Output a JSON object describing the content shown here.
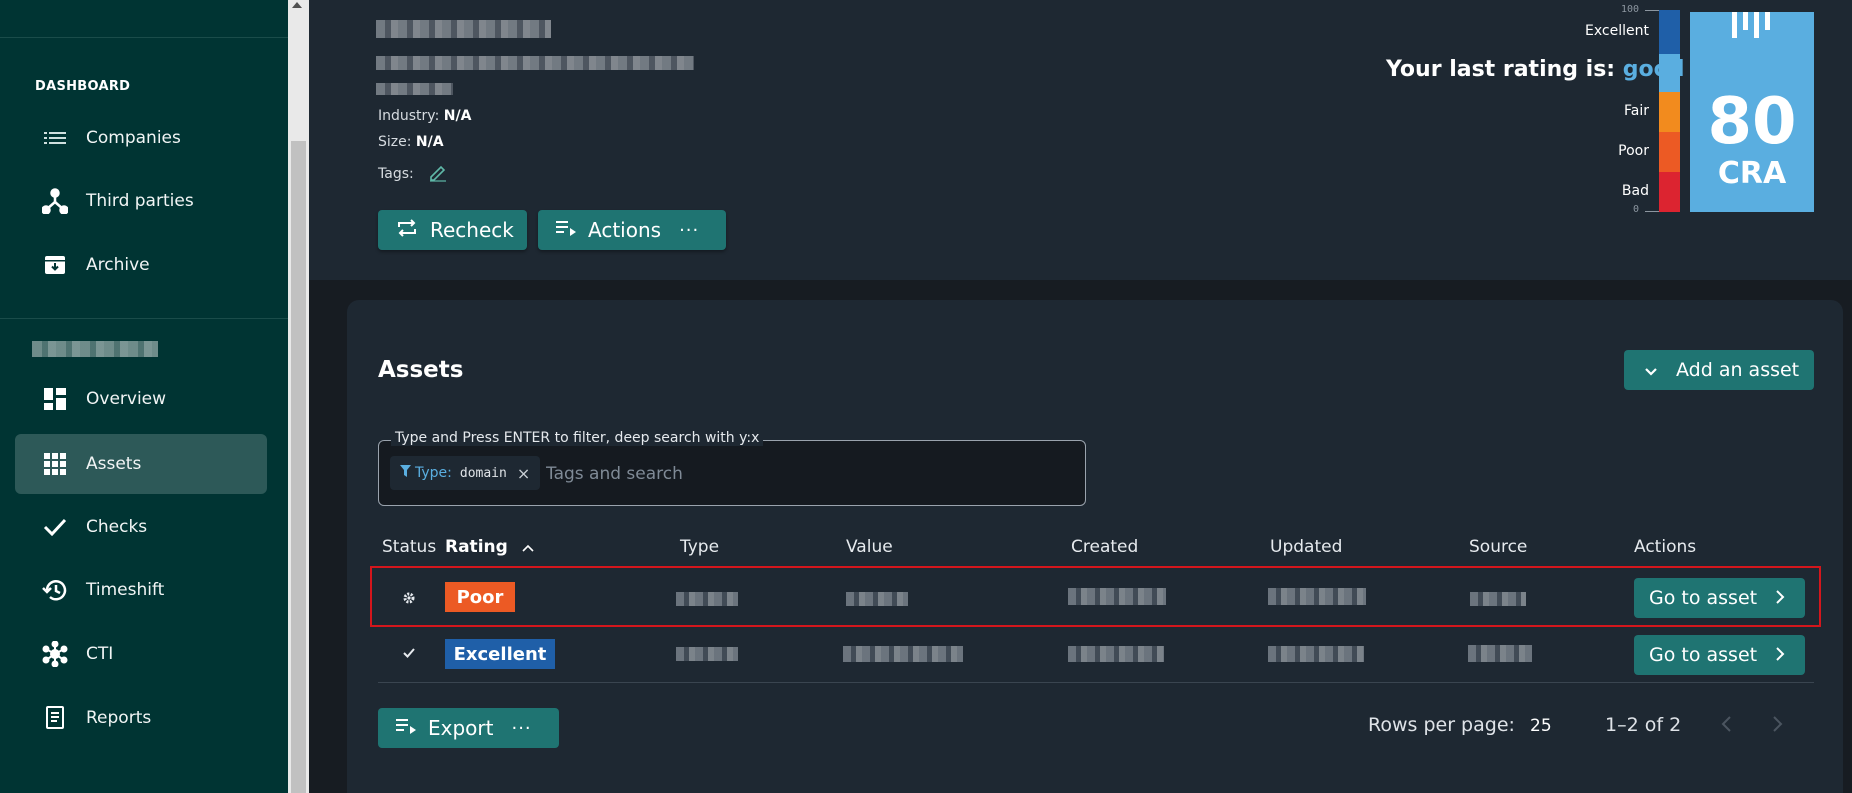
{
  "sidebar": {
    "section_heading": "DASHBOARD",
    "items_top": [
      {
        "label": "Companies",
        "icon": "list-icon"
      },
      {
        "label": "Third parties",
        "icon": "network-icon"
      },
      {
        "label": "Archive",
        "icon": "archive-icon"
      }
    ],
    "items_company": [
      {
        "label": "Overview",
        "icon": "overview-grid-icon"
      },
      {
        "label": "Assets",
        "icon": "apps-grid-icon",
        "active": true
      },
      {
        "label": "Checks",
        "icon": "check-icon"
      },
      {
        "label": "Timeshift",
        "icon": "history-icon"
      },
      {
        "label": "CTI",
        "icon": "hub-icon"
      },
      {
        "label": "Reports",
        "icon": "report-icon"
      }
    ]
  },
  "company": {
    "industry_label": "Industry:",
    "industry_value": "N/A",
    "size_label": "Size:",
    "size_value": "N/A",
    "tags_label": "Tags:"
  },
  "header_actions": {
    "recheck_label": "Recheck",
    "actions_label": "Actions",
    "more_glyph": "···"
  },
  "rating": {
    "prefix": "Your last rating is:",
    "value": "good",
    "score": "80",
    "code": "CRA",
    "scale_max": "100",
    "scale_min": "0",
    "scale_labels": [
      "Excellent",
      "Fair",
      "Poor",
      "Bad"
    ],
    "colors": {
      "excellent": "#1f5fa8",
      "good": "#5aaee0",
      "fair": "#f28b1e",
      "poor": "#ec5a24",
      "bad": "#dc2430"
    }
  },
  "assets": {
    "title": "Assets",
    "add_label": "Add an asset",
    "search": {
      "legend": "Type and Press ENTER to filter, deep search with y:x",
      "chip_key": "Type:",
      "chip_value": "domain",
      "chip_remove": "×",
      "placeholder": "Tags and search"
    },
    "columns": [
      "Status",
      "Rating",
      "Type",
      "Value",
      "Created",
      "Updated",
      "Source",
      "Actions"
    ],
    "sort_indicator": "^",
    "rows": [
      {
        "status_icon": "gear-icon",
        "rating": "Poor",
        "rating_color": "#ec5a24",
        "action": "Go to asset"
      },
      {
        "status_icon": "check-icon",
        "rating": "Excellent",
        "rating_color": "#1f5fa8",
        "action": "Go to asset"
      }
    ],
    "footer": {
      "export_label": "Export",
      "rows_per_page_label": "Rows per page:",
      "rows_per_page_value": "25",
      "range": "1–2 of 2"
    }
  }
}
